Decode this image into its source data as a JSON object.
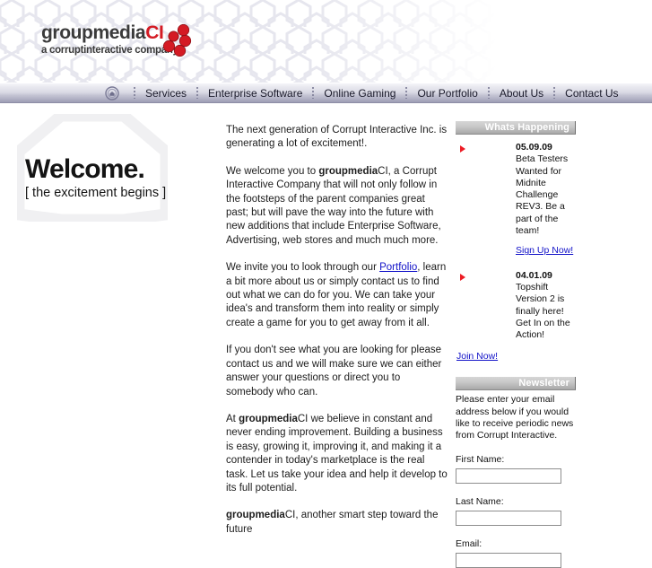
{
  "header": {
    "logo_primary": "groupmedia",
    "logo_accent": "CI",
    "logo_tagline": "a corruptinteractive company",
    "accent_color": "#d41b24"
  },
  "nav": {
    "home_icon": "home-icon",
    "items": [
      "Services",
      "Enterprise Software",
      "Online Gaming",
      "Our Portfolio",
      "About Us",
      "Contact Us"
    ]
  },
  "left": {
    "title": "Welcome.",
    "subtitle": "[ the excitement begins ]"
  },
  "main": {
    "paragraphs": [
      {
        "id": "p1",
        "runs": [
          {
            "text": "The next generation of Corrupt Interactive Inc. is generating a lot of excitement!."
          }
        ]
      },
      {
        "id": "p2",
        "runs": [
          {
            "text": "We welcome you to "
          },
          {
            "text": "groupmedia",
            "style": "bold"
          },
          {
            "text": "CI, a Corrupt Interactive Company that will not only follow in the footsteps of the parent companies great past; but will pave the way into the future with new additions that include Enterprise Software, Advertising, web stores and much much more."
          }
        ]
      },
      {
        "id": "p3",
        "runs": [
          {
            "text": "We invite you to look through our "
          },
          {
            "text": "Portfolio",
            "style": "link"
          },
          {
            "text": ", learn a bit more about us or simply contact us to find out what we can do for you. We can take your idea's and transform them into reality or simply create a game for you to get away from it all."
          }
        ]
      },
      {
        "id": "p4",
        "runs": [
          {
            "text": "If you don't see what you are looking for please contact us and we will make sure we can either answer your questions or direct you to somebody who can."
          }
        ]
      },
      {
        "id": "p5",
        "runs": [
          {
            "text": "At "
          },
          {
            "text": "groupmedia",
            "style": "bold"
          },
          {
            "text": "CI we believe in constant and never ending improvement.  Building a business is easy, growing it, improving it, and making it a contender in today's marketplace is the real task.  Let us take your idea and help it develop to its full potential."
          }
        ]
      },
      {
        "id": "p6",
        "runs": [
          {
            "text": "groupmedia",
            "style": "bold"
          },
          {
            "text": "CI, another smart step toward the future"
          }
        ]
      }
    ]
  },
  "sidebar": {
    "whats_happening": {
      "title": "Whats Happening",
      "items": [
        {
          "date": "05.09.09",
          "body": "Beta Testers Wanted for Midnite Challenge REV3. Be a part of the team!",
          "link": "Sign Up Now!"
        },
        {
          "date": "04.01.09",
          "body": "Topshift Version 2 is finally here! Get In on the Action!",
          "link": ""
        }
      ],
      "join_link": "Join Now!"
    },
    "newsletter": {
      "title": "Newsletter",
      "description": "Please enter your email address below if you would like to receive periodic news from Corrupt Interactive.",
      "fields": [
        {
          "label": "First Name:",
          "value": "",
          "name": "first-name"
        },
        {
          "label": "Last Name:",
          "value": "",
          "name": "last-name"
        },
        {
          "label": "Email:",
          "value": "",
          "name": "email"
        }
      ]
    }
  }
}
